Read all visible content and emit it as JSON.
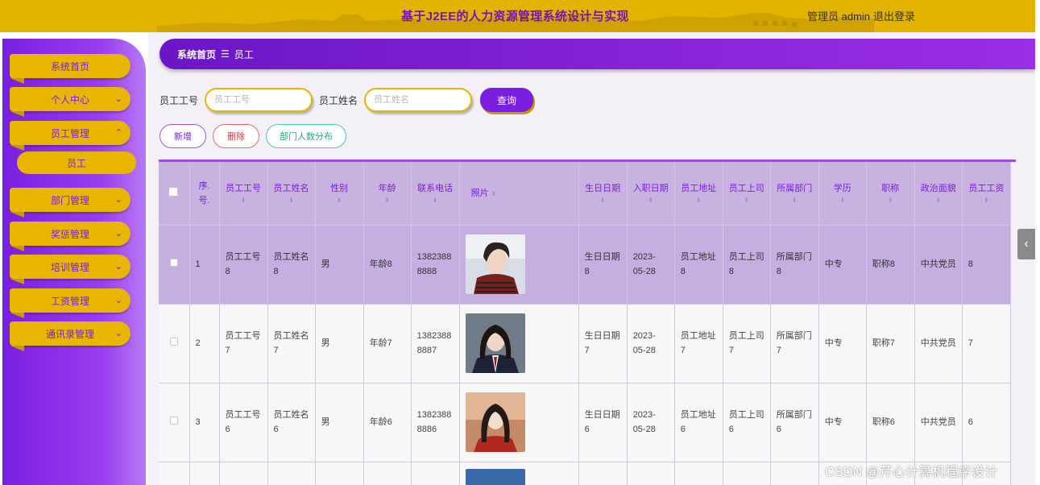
{
  "header": {
    "title": "基于J2EE的人力资源管理系统设计与实现",
    "user_text": "管理员 admin",
    "logout_label": "退出登录"
  },
  "sidebar": {
    "items": [
      {
        "label": "系统首页",
        "has_chevron": false
      },
      {
        "label": "个人中心",
        "has_chevron": true,
        "chevron": "⌄"
      },
      {
        "label": "员工管理",
        "has_chevron": true,
        "chevron": "⌃",
        "expanded": true,
        "sub": "员工"
      },
      {
        "label": "部门管理",
        "has_chevron": true,
        "chevron": "⌄"
      },
      {
        "label": "奖惩管理",
        "has_chevron": true,
        "chevron": "⌄"
      },
      {
        "label": "培训管理",
        "has_chevron": true,
        "chevron": "⌄"
      },
      {
        "label": "工资管理",
        "has_chevron": true,
        "chevron": "⌄"
      },
      {
        "label": "通讯录管理",
        "has_chevron": true,
        "chevron": "⌄"
      }
    ]
  },
  "breadcrumb": {
    "home": "系统首页",
    "separator": "☰",
    "current": "员工"
  },
  "search": {
    "emp_no_label": "员工工号",
    "emp_no_placeholder": "员工工号",
    "emp_name_label": "员工姓名",
    "emp_name_placeholder": "员工姓名",
    "query_label": "查询"
  },
  "actions": {
    "add": "新增",
    "delete": "删除",
    "dept_count": "部门人数分布"
  },
  "table": {
    "headers": {
      "index": "序.号.",
      "emp_no": "员工工号",
      "emp_name": "员工姓名",
      "gender": "性别",
      "age": "年龄",
      "phone": "联系电话",
      "photo": "照片",
      "birthday": "生日日期",
      "hire_date": "入职日期",
      "address": "员工地址",
      "superior": "员工上司",
      "department": "所属部门",
      "education": "学历",
      "title": "职称",
      "political": "政治面貌",
      "salary": "员工工资"
    },
    "rows": [
      {
        "index": "1",
        "emp_no": "员工工号8",
        "emp_name": "员工姓名8",
        "gender": "男",
        "age": "年龄8",
        "phone": "13823888888",
        "birthday": "生日日期8",
        "hire_date": "2023-05-28",
        "address": "员工地址8",
        "superior": "员工上司8",
        "department": "所属部门8",
        "education": "中专",
        "title": "职称8",
        "political": "中共党员",
        "salary": "8"
      },
      {
        "index": "2",
        "emp_no": "员工工号7",
        "emp_name": "员工姓名7",
        "gender": "男",
        "age": "年龄7",
        "phone": "13823888887",
        "birthday": "生日日期7",
        "hire_date": "2023-05-28",
        "address": "员工地址7",
        "superior": "员工上司7",
        "department": "所属部门7",
        "education": "中专",
        "title": "职称7",
        "political": "中共党员",
        "salary": "7"
      },
      {
        "index": "3",
        "emp_no": "员工工号6",
        "emp_name": "员工姓名6",
        "gender": "男",
        "age": "年龄6",
        "phone": "13823888886",
        "birthday": "生日日期6",
        "hire_date": "2023-05-28",
        "address": "员工地址6",
        "superior": "员工上司6",
        "department": "所属部门6",
        "education": "中专",
        "title": "职称6",
        "political": "中共党员",
        "salary": "6"
      }
    ]
  },
  "watermark": "CSDN @芹心计算机程序设计",
  "colors": {
    "header_bg": "#e2b400",
    "brand_purple": "#7a1ee0",
    "accent_gold": "#e8b600",
    "highlight_row": "#c5aee0"
  }
}
